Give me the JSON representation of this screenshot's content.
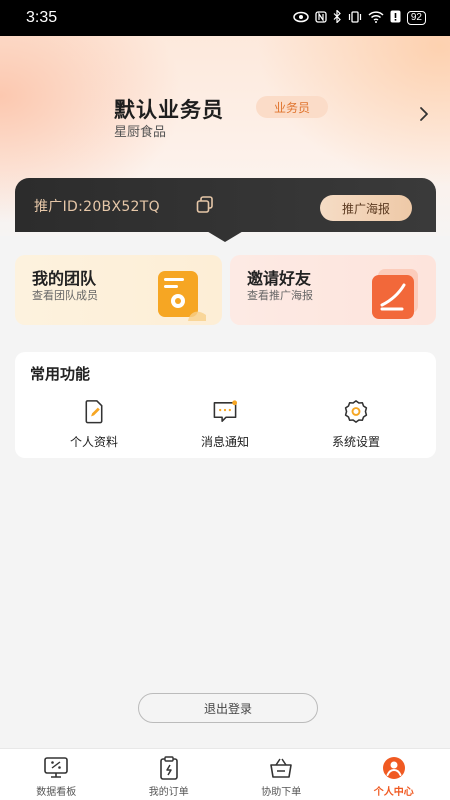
{
  "status_bar": {
    "time": "3:35",
    "battery": "92"
  },
  "profile": {
    "name": "默认业务员",
    "role_badge": "业务员",
    "company": "星厨食品"
  },
  "promotion": {
    "id_text": "推广ID:20BX52TQ",
    "poster_button": "推广海报"
  },
  "quick_cards": [
    {
      "title": "我的团队",
      "subtitle": "查看团队成员",
      "icon": "team-folder-icon"
    },
    {
      "title": "邀请好友",
      "subtitle": "查看推广海报",
      "icon": "invite-poster-icon"
    }
  ],
  "functions": {
    "title": "常用功能",
    "items": [
      {
        "label": "个人资料",
        "icon": "edit-document-icon"
      },
      {
        "label": "消息通知",
        "icon": "message-icon"
      },
      {
        "label": "系统设置",
        "icon": "gear-icon"
      }
    ]
  },
  "logout_label": "退出登录",
  "tabbar": {
    "items": [
      {
        "label": "数据看板",
        "icon": "dashboard-monitor-icon",
        "active": false
      },
      {
        "label": "我的订单",
        "icon": "order-clipboard-icon",
        "active": false
      },
      {
        "label": "协助下单",
        "icon": "basket-icon",
        "active": false
      },
      {
        "label": "个人中心",
        "icon": "user-icon",
        "active": true
      }
    ]
  },
  "colors": {
    "accent": "#f05a22",
    "badge_text": "#e0742e",
    "promo_dark": "#2c2c2c",
    "promo_gold": "#e6c7a8"
  }
}
